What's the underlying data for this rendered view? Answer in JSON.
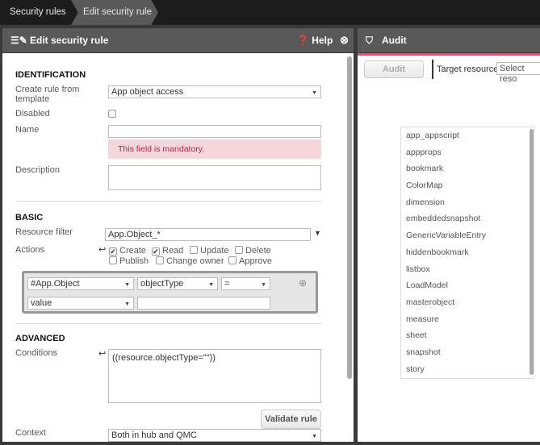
{
  "breadcrumb": {
    "items": [
      "Security rules",
      "Edit security rule"
    ]
  },
  "editor": {
    "title": "Edit security rule",
    "help": "Help",
    "identification": {
      "heading": "IDENTIFICATION",
      "template_label": "Create rule from template",
      "template_value": "App object access",
      "disabled_label": "Disabled",
      "name_label": "Name",
      "name_value": "",
      "name_error": "This field is mandatory.",
      "description_label": "Description",
      "description_value": ""
    },
    "basic": {
      "heading": "BASIC",
      "resource_filter_label": "Resource filter",
      "resource_filter_value": "App.Object_*",
      "actions_label": "Actions",
      "actions": [
        {
          "label": "Create",
          "checked": true
        },
        {
          "label": "Read",
          "checked": true
        },
        {
          "label": "Update",
          "checked": false
        },
        {
          "label": "Delete",
          "checked": false
        },
        {
          "label": "Publish",
          "checked": false
        },
        {
          "label": "Change owner",
          "checked": false
        },
        {
          "label": "Approve",
          "checked": false
        }
      ],
      "condition": {
        "resource": "#App.Object",
        "property": "objectType",
        "operator": "=",
        "value_type": "value",
        "value": ""
      }
    },
    "advanced": {
      "heading": "ADVANCED",
      "conditions_label": "Conditions",
      "conditions_value": "((resource.objectType=\"\"))",
      "validate": "Validate rule",
      "context_label": "Context",
      "context_value": "Both in hub and QMC"
    }
  },
  "audit": {
    "title": "Audit",
    "button": "Audit",
    "target_label": "Target resource",
    "target_placeholder": "Select reso",
    "options": [
      "app_appscript",
      "appprops",
      "bookmark",
      "ColorMap",
      "dimension",
      "embeddedsnapshot",
      "GenericVariableEntry",
      "hiddenbookmark",
      "listbox",
      "LoadModel",
      "masterobject",
      "measure",
      "sheet",
      "snapshot",
      "story"
    ]
  }
}
